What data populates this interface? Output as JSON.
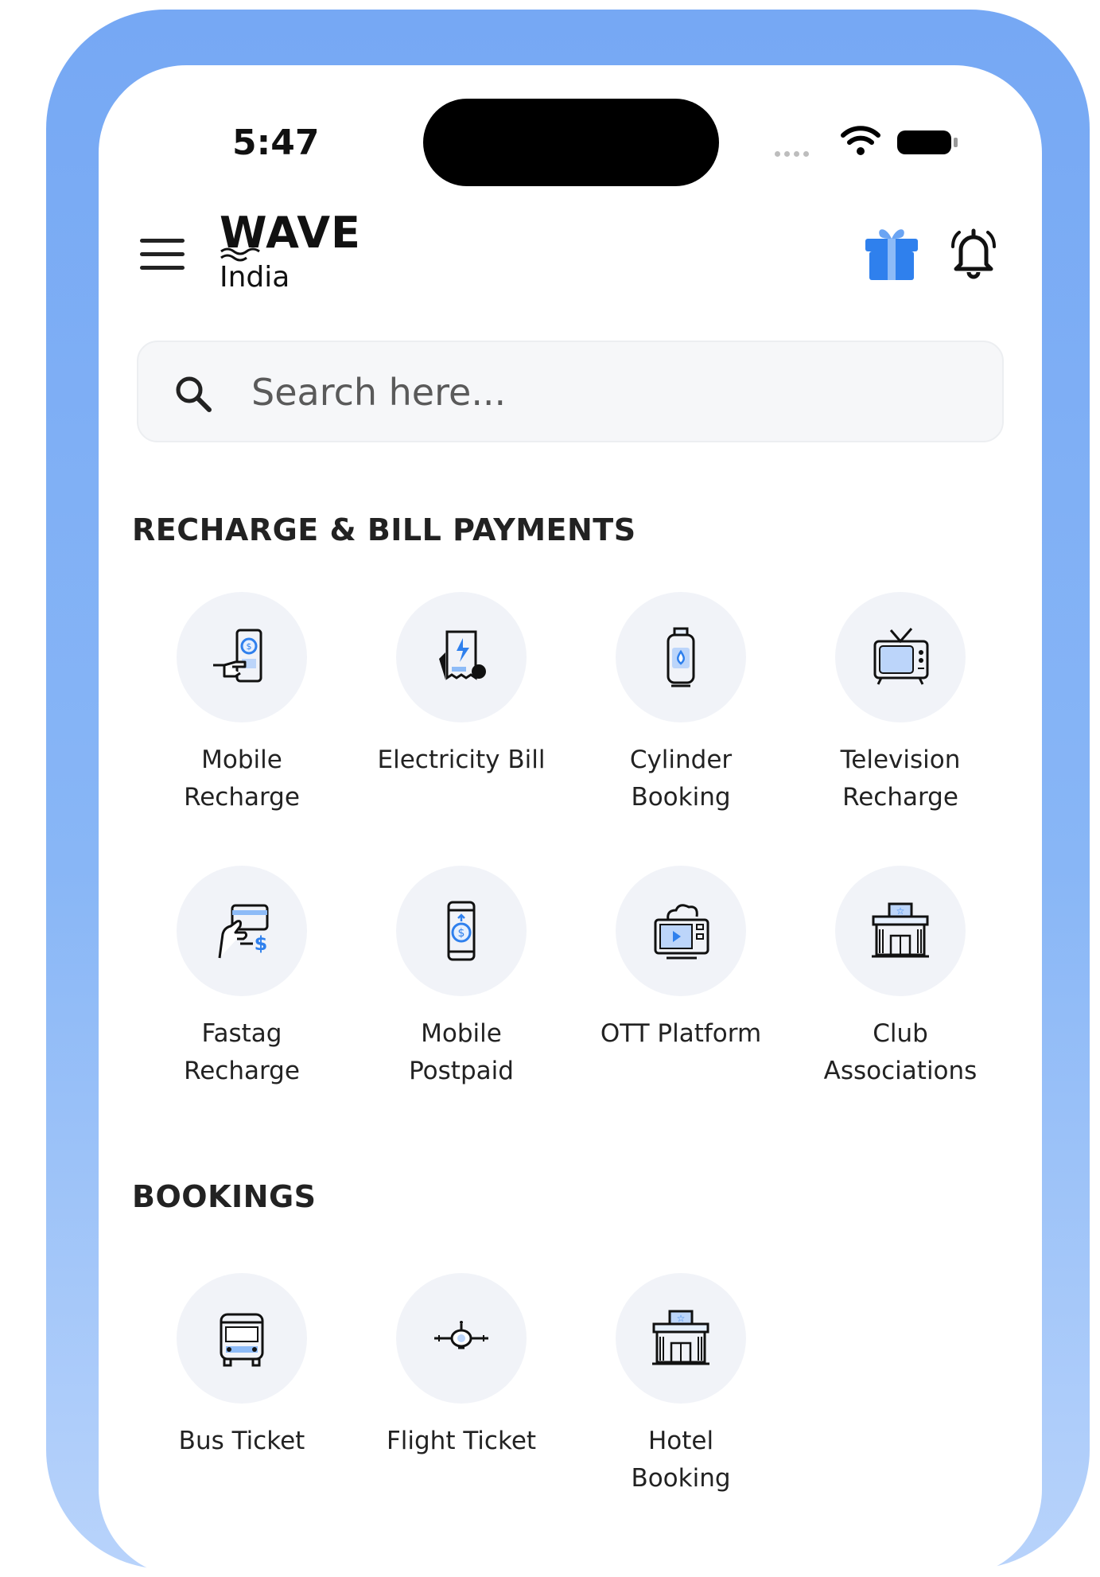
{
  "status_bar": {
    "time": "5:47"
  },
  "header": {
    "brand": "WAVE",
    "country": "India"
  },
  "search": {
    "placeholder": "Search here..."
  },
  "sections": [
    {
      "title": "RECHARGE & BILL PAYMENTS",
      "items": [
        {
          "label_line1": "Mobile",
          "label_line2": "Recharge",
          "icon": "mobile-recharge-icon"
        },
        {
          "label_line1": "Electricity Bill",
          "label_line2": "",
          "icon": "electricity-bill-icon"
        },
        {
          "label_line1": "Cylinder",
          "label_line2": "Booking",
          "icon": "gas-cylinder-icon"
        },
        {
          "label_line1": "Television",
          "label_line2": "Recharge",
          "icon": "television-icon"
        },
        {
          "label_line1": "Fastag",
          "label_line2": "Recharge",
          "icon": "fastag-card-icon"
        },
        {
          "label_line1": "Mobile",
          "label_line2": "Postpaid",
          "icon": "mobile-postpaid-icon"
        },
        {
          "label_line1": "OTT Platform",
          "label_line2": "",
          "icon": "ott-platform-icon"
        },
        {
          "label_line1": "Club",
          "label_line2": "Associations",
          "icon": "club-building-icon"
        }
      ]
    },
    {
      "title": "BOOKINGS",
      "items": [
        {
          "label_line1": "Bus Ticket",
          "label_line2": "",
          "icon": "bus-icon"
        },
        {
          "label_line1": "Flight Ticket",
          "label_line2": "",
          "icon": "airplane-icon"
        },
        {
          "label_line1": "Hotel",
          "label_line2": "Booking",
          "icon": "hotel-building-icon"
        }
      ]
    }
  ],
  "colors": {
    "accent": "#2f80ed",
    "frame": "#7aabf5",
    "icon_circle": "#f1f3f8"
  }
}
